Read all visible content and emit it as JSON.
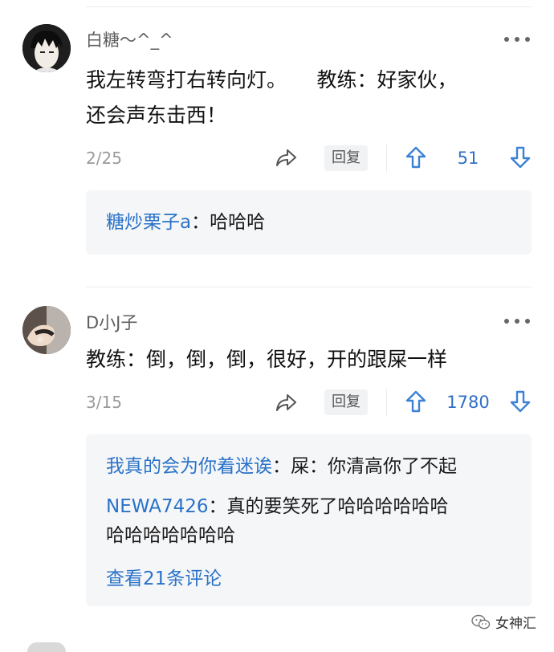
{
  "comments": [
    {
      "username": "白糖～^_^",
      "content_line1": "我左转弯打右转向灯。　　教练：好家伙，",
      "content_line2": "还会声东击西！",
      "date": "2/25",
      "reply_label": "回复",
      "votes": "51",
      "replies": [
        {
          "user": "糖炒栗子a",
          "sep": "：",
          "text": "哈哈哈"
        }
      ]
    },
    {
      "username": "D小J子",
      "content_line1": "教练：倒，倒，倒，很好，开的跟屎一样",
      "date": "3/15",
      "reply_label": "回复",
      "votes": "1780",
      "replies": [
        {
          "user": "我真的会为你着迷诶",
          "sep": "：",
          "text": "屎：你清高你了不起"
        },
        {
          "user": "NEWA7426",
          "sep": "：",
          "text": "真的要笑死了哈哈哈哈哈哈",
          "text2": "哈哈哈哈哈哈哈"
        }
      ],
      "view_more": "查看21条评论"
    }
  ],
  "watermark": "女神汇",
  "colors": {
    "accent": "#2a72c8",
    "reply_bg": "#f5f6f8",
    "vote_icon": "#3b82d6"
  },
  "icons": [
    "more-icon",
    "share-icon",
    "upvote-icon",
    "downvote-icon",
    "wechat-icon"
  ]
}
